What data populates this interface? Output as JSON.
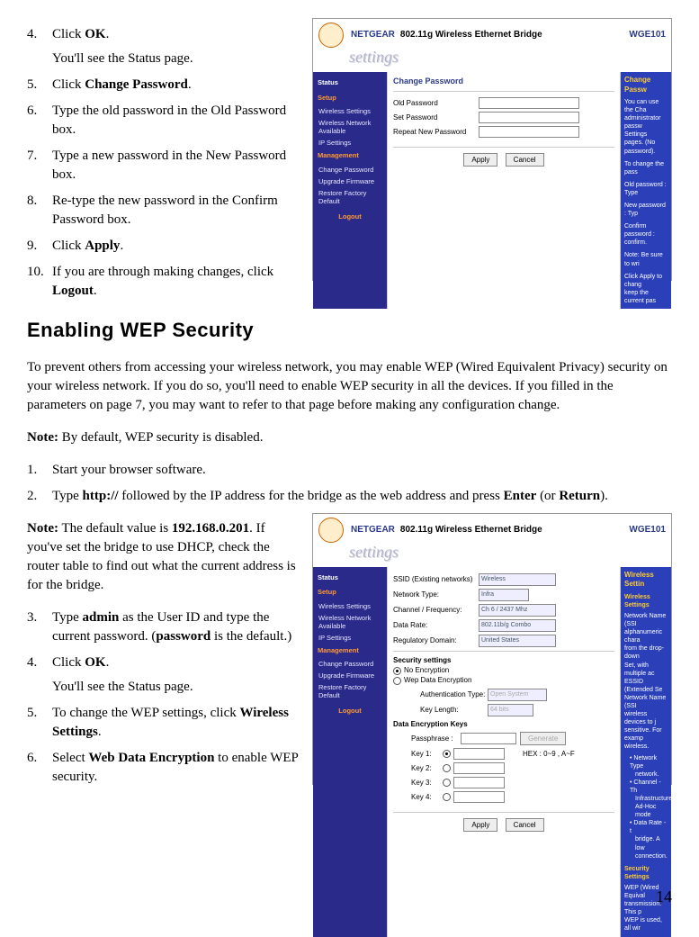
{
  "steps_a": [
    {
      "num": "4.",
      "text": "Click ",
      "bold": "OK",
      "after": ".",
      "sub": "You'll see the Status page."
    },
    {
      "num": "5.",
      "text": "Click ",
      "bold": "Change Password",
      "after": "."
    },
    {
      "num": "6.",
      "text": "Type the old password in the Old Password box."
    },
    {
      "num": "7.",
      "text": "Type a new password in the New Password box."
    },
    {
      "num": "8.",
      "text": "Re-type the new password in the Confirm Password box."
    },
    {
      "num": "9.",
      "text": "Click ",
      "bold": "Apply",
      "after": "."
    },
    {
      "num": "10.",
      "text": "If you are through making changes, click ",
      "bold": "Logout",
      "after": "."
    }
  ],
  "heading": "Enabling WEP Security",
  "para1": "To prevent others from accessing your wireless network, you may enable WEP (Wired Equivalent Privacy) security on your wireless network. If you do so, you'll need to enable WEP security in all the devices. If you filled in the parameters on page 7, you may want to refer to that page before making any configuration change.",
  "note1_pre": "Note:",
  "note1": " By default, WEP security is disabled.",
  "steps_b1": [
    {
      "num": "1.",
      "text": "Start your browser software."
    },
    {
      "num": "2.",
      "text": "Type ",
      "bold": "http://",
      "after": " followed by the IP address for the bridge as the web address and press ",
      "bold2": "Enter",
      "after2": " (or ",
      "bold3": "Return",
      "after3": ")."
    }
  ],
  "note2_pre": "Note:",
  "note2a": " The default value is ",
  "note2_b": "192.168.0.201",
  "note2c": ". If you've set the bridge to use DHCP, check the router table to find out what the current address is for the bridge.",
  "steps_b2": [
    {
      "num": "3.",
      "text": "Type ",
      "bold": "admin",
      "after": " as the User ID and type the current password. (",
      "bold2": "password",
      "after2": " is the default.)"
    },
    {
      "num": "4.",
      "text": "Click ",
      "bold": "OK",
      "after": ".",
      "sub": "You'll see the Status page."
    },
    {
      "num": "5.",
      "text": "To change the WEP settings, click ",
      "bold": "Wireless Settings",
      "after": "."
    },
    {
      "num": "6.",
      "text": "Select ",
      "bold": "Web Data Encryption",
      "after": " to enable WEP security."
    }
  ],
  "page_num": "14",
  "ng": {
    "brand": "NETGEAR",
    "title": "802.11g Wireless Ethernet Bridge",
    "model": "WGE101",
    "settings_word": "settings",
    "sidebar": {
      "status": "Status",
      "setup": "Setup",
      "wireless": "Wireless Settings",
      "wnet": "Wireless Network Available",
      "ip": "IP Settings",
      "mgmt": "Management",
      "cpw": "Change Password",
      "upgrade": "Upgrade Firmware",
      "restore": "Restore Factory Default",
      "logout": "Logout"
    },
    "pw": {
      "title": "Change Password",
      "old": "Old Password",
      "set": "Set Password",
      "repeat": "Repeat New Password",
      "apply": "Apply",
      "cancel": "Cancel"
    },
    "help_pw": {
      "title": "Change Passw",
      "l1": "You can use the Cha",
      "l2": "administrator passw",
      "l3": "Settings pages. (No",
      "l4": "password).",
      "l5": "To change the pass",
      "l6": "Old password : Type",
      "l7": "New password : Typ",
      "l8": "Confirm password :",
      "l9": "confirm.",
      "l10": "Note: Be sure to wri",
      "l11": "Click Apply to chang",
      "l12": "keep the current pas"
    },
    "ws": {
      "title_ssid": "SSID (Existing networks)",
      "ssid_val": "Wireless",
      "nettype": "Network Type:",
      "nettype_val": "Infra",
      "chan": "Channel / Frequency:",
      "chan_val": "Ch 6 / 2437 Mhz",
      "rate": "Data Rate:",
      "rate_val": "802.11b/g Combo",
      "reg": "Regulatory Domain:",
      "reg_val": "United States",
      "sec": "Security settings",
      "noenc": "No Encryption",
      "wepenc": "Wep Data Encryption",
      "auth": "Authentication Type:",
      "auth_val": "Open System",
      "klen": "Key Length:",
      "klen_val": "64 bits",
      "dek": "Data Encryption Keys",
      "pass": "Passphrase :",
      "gen": "Generate",
      "hex": "HEX : 0~9 , A~F",
      "k1": "Key 1:",
      "k2": "Key 2:",
      "k3": "Key 3:",
      "k4": "Key 4:",
      "apply": "Apply",
      "cancel": "Cancel"
    },
    "help_ws": {
      "title": "Wireless Settin",
      "sub": "Wireless Settings",
      "l1": "Network Name (SSI",
      "l2": "alphanumeric chara",
      "l3": "from the drop-down",
      "l4": "Set, with multiple ac",
      "l5": "ESSID (Extended Se",
      "l6": "Network Name (SSI",
      "l7": "wireless devices to j",
      "l8": "sensitive. For examp",
      "l9": "wireless.",
      "b1": "Network Type",
      "b1b": "network.",
      "b2": "Channel - Th",
      "b2b": "Infrastructure",
      "b2c": "Ad-Hoc mode",
      "b3": "Data Rate - t",
      "b3b": "bridge. A low",
      "b3c": "connection.",
      "sec": "Security Settings",
      "s1": "WEP (Wired Equival",
      "s2": "transmission. This p",
      "s3": "WEP is used, all wir"
    }
  }
}
